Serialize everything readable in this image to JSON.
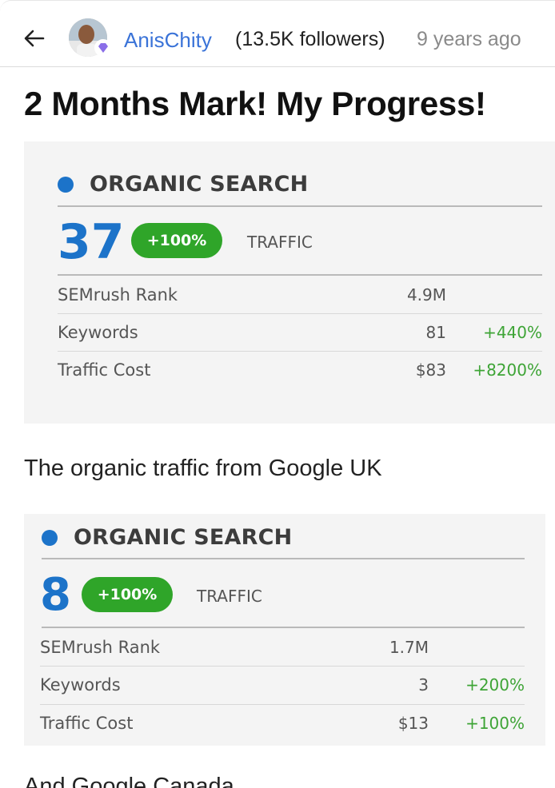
{
  "header": {
    "author": "AnisChity",
    "followers": "(13.5K followers)",
    "time_ago": "9 years ago"
  },
  "post": {
    "title": "2 Months Mark! My Progress!",
    "caption_1": "The organic traffic from Google UK",
    "caption_2": "And Google Canada"
  },
  "cards": [
    {
      "heading": "ORGANIC SEARCH",
      "big_number": "37",
      "badge": "+100%",
      "traffic_label": "TRAFFIC",
      "rows": [
        {
          "label": "SEMrush Rank",
          "value": "4.9M",
          "change": ""
        },
        {
          "label": "Keywords",
          "value": "81",
          "change": "+440%"
        },
        {
          "label": "Traffic Cost",
          "value": "$83",
          "change": "+8200%"
        }
      ]
    },
    {
      "heading": "ORGANIC SEARCH",
      "big_number": "8",
      "badge": "+100%",
      "traffic_label": "TRAFFIC",
      "rows": [
        {
          "label": "SEMrush Rank",
          "value": "1.7M",
          "change": ""
        },
        {
          "label": "Keywords",
          "value": "3",
          "change": "+200%"
        },
        {
          "label": "Traffic Cost",
          "value": "$13",
          "change": "+100%"
        }
      ]
    }
  ],
  "colors": {
    "brand_blue": "#1c73c9",
    "link_blue": "#3a73d8",
    "badge_green": "#2fa529",
    "change_green": "#3ea436"
  },
  "icons": {
    "back": "back-arrow-icon",
    "badge": "diamond-icon"
  }
}
